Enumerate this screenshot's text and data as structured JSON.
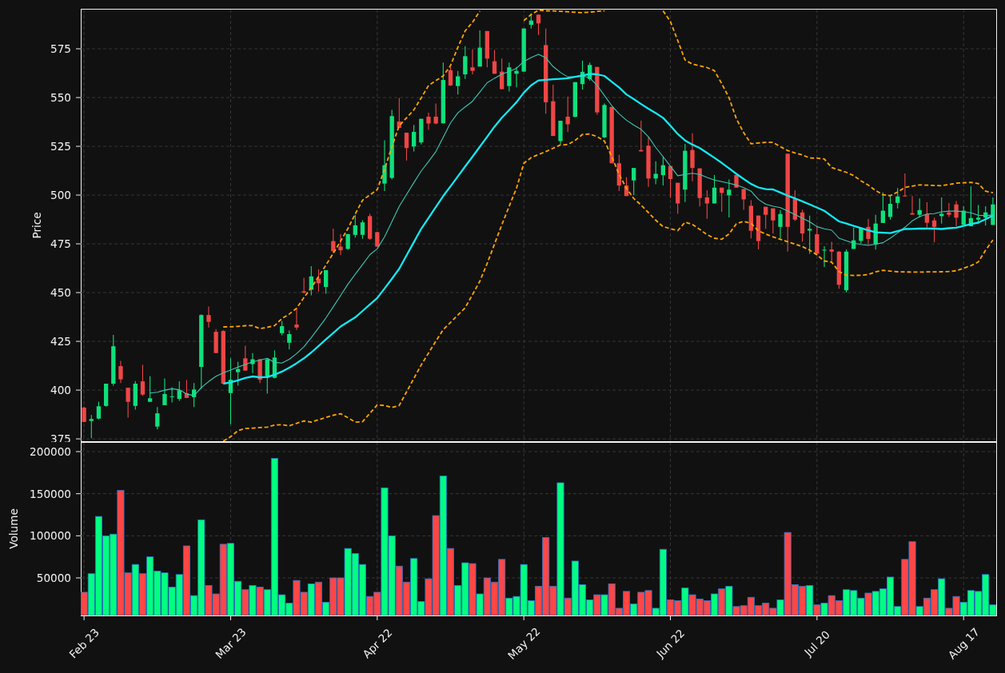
{
  "price_chart": {
    "chart_data": {
      "type": "candlestick",
      "ylabel": "Price",
      "grid": true,
      "ylim": [
        373.8,
        595.1
      ],
      "yticks": [
        375,
        400,
        425,
        450,
        475,
        500,
        525,
        550,
        575
      ],
      "categories": [
        null,
        null,
        null,
        null,
        null,
        null,
        null,
        null,
        null,
        null,
        null,
        null,
        null,
        null,
        null,
        null,
        null,
        null,
        null,
        null,
        null,
        null,
        null,
        null,
        null,
        null,
        null,
        null,
        null,
        null,
        null,
        null,
        null,
        null,
        null,
        null,
        null,
        null,
        null,
        null,
        null,
        null,
        null,
        null,
        null,
        null,
        null,
        null,
        null,
        null,
        null,
        null,
        null,
        null,
        null,
        null,
        null,
        null,
        null,
        null,
        null,
        null,
        null,
        null,
        null,
        null,
        null,
        null,
        null,
        null,
        null,
        null,
        null,
        null,
        null,
        null,
        null,
        null,
        null,
        null,
        null,
        null,
        null,
        null,
        null,
        null,
        null,
        null,
        null,
        null,
        null,
        null,
        null,
        null,
        null,
        null,
        null,
        null,
        null,
        null,
        null,
        null,
        null,
        null,
        null,
        null,
        null,
        null,
        null,
        null,
        null,
        null,
        null,
        null,
        null,
        null,
        null,
        null,
        null,
        null,
        null,
        null,
        null,
        null,
        null
      ],
      "ohlc": [
        [
          391.0,
          391.5,
          383.5,
          383.7
        ],
        [
          384.2,
          387.2,
          375.3,
          385.2
        ],
        [
          385.4,
          394.1,
          385.0,
          391.7
        ],
        [
          391.9,
          403.3,
          391.5,
          403.3
        ],
        [
          403.3,
          428.3,
          402.3,
          422.5
        ],
        [
          412.3,
          415.0,
          403.6,
          405.5
        ],
        [
          401.2,
          401.2,
          385.9,
          394.0
        ],
        [
          391.9,
          404.6,
          390.0,
          403.3
        ],
        [
          404.5,
          413.0,
          397.0,
          397.7
        ],
        [
          394.0,
          407.2,
          394.0,
          395.8
        ],
        [
          381.3,
          391.3,
          379.8,
          388.1
        ],
        [
          392.3,
          406.0,
          392.3,
          398.0
        ],
        [
          396.5,
          401.5,
          393.7,
          396.8
        ],
        [
          395.5,
          404.5,
          394.5,
          399.9
        ],
        [
          398.4,
          405.2,
          396.0,
          396.0
        ],
        [
          396.4,
          403.6,
          391.3,
          400.3
        ],
        [
          411.9,
          438.9,
          400.5,
          438.5
        ],
        [
          438.5,
          442.9,
          432.1,
          435.0
        ],
        [
          429.9,
          431.3,
          419.0,
          419.0
        ],
        [
          430.3,
          430.8,
          403.0,
          403.3
        ],
        [
          398.5,
          416.3,
          382.5,
          405.3
        ],
        [
          409.2,
          414.6,
          402.3,
          410.8
        ],
        [
          416.3,
          422.8,
          410.0,
          410.0
        ],
        [
          413.3,
          419.0,
          408.7,
          415.8
        ],
        [
          415.8,
          416.0,
          403.6,
          405.3
        ],
        [
          406.4,
          416.0,
          398.2,
          415.8
        ],
        [
          406.3,
          420.4,
          406.0,
          416.7
        ],
        [
          429.2,
          435.4,
          428.1,
          432.8
        ],
        [
          424.3,
          430.6,
          420.8,
          428.7
        ],
        [
          433.6,
          441.8,
          430.9,
          432.1
        ],
        [
          450.7,
          457.6,
          449.5,
          450.0
        ],
        [
          451.5,
          463.6,
          448.6,
          458.3
        ],
        [
          457.2,
          461.9,
          450.5,
          454.8
        ],
        [
          452.9,
          461.5,
          449.4,
          461.5
        ],
        [
          476.4,
          482.8,
          470.3,
          471.2
        ],
        [
          473.6,
          480.0,
          469.3,
          471.7
        ],
        [
          472.4,
          480.0,
          472.0,
          480.0
        ],
        [
          479.6,
          490.0,
          478.2,
          484.5
        ],
        [
          479.6,
          487.1,
          477.6,
          486.0
        ],
        [
          489.2,
          490.4,
          477.1,
          477.6
        ],
        [
          481.0,
          481.2,
          473.4,
          473.6
        ],
        [
          505.9,
          528.1,
          502.1,
          515.3
        ],
        [
          508.8,
          543.7,
          508.0,
          540.5
        ],
        [
          537.7,
          549.8,
          534.5,
          534.5
        ],
        [
          532.0,
          532.0,
          517.7,
          524.1
        ],
        [
          524.9,
          536.0,
          522.4,
          532.4
        ],
        [
          527.0,
          539.1,
          525.9,
          539.1
        ],
        [
          540.2,
          542.2,
          533.4,
          536.7
        ],
        [
          540.2,
          546.9,
          536.3,
          536.7
        ],
        [
          536.8,
          568.0,
          536.6,
          559.0
        ],
        [
          564.0,
          565.7,
          555.9,
          556.2
        ],
        [
          555.9,
          563.6,
          551.6,
          560.9
        ],
        [
          561.9,
          576.3,
          559.5,
          571.2
        ],
        [
          565.5,
          574.7,
          561.9,
          563.7
        ],
        [
          565.9,
          584.4,
          565.9,
          575.6
        ],
        [
          584.1,
          584.1,
          565.5,
          570.0
        ],
        [
          568.6,
          574.4,
          562.2,
          562.2
        ],
        [
          563.3,
          570.0,
          554.3,
          554.3
        ],
        [
          555.9,
          568.0,
          553.1,
          565.5
        ],
        [
          562.2,
          565.7,
          555.2,
          563.7
        ],
        [
          563.3,
          585.4,
          563.3,
          585.4
        ],
        [
          587.3,
          593.2,
          585.4,
          589.5
        ],
        [
          592.5,
          592.5,
          582.1,
          588.0
        ],
        [
          576.9,
          585.4,
          541.7,
          547.6
        ],
        [
          548.1,
          556.6,
          530.3,
          530.3
        ],
        [
          527.7,
          538.1,
          526.0,
          538.1
        ],
        [
          540.2,
          550.5,
          532.4,
          536.3
        ],
        [
          540.1,
          557.9,
          540.0,
          557.9
        ],
        [
          556.9,
          568.9,
          554.1,
          563.2
        ],
        [
          559.5,
          568.0,
          558.6,
          566.7
        ],
        [
          565.7,
          565.7,
          541.2,
          542.4
        ],
        [
          529.6,
          547.0,
          529.1,
          546.2
        ],
        [
          545.2,
          545.2,
          516.3,
          516.3
        ],
        [
          516.3,
          520.6,
          502.1,
          504.9
        ],
        [
          504.9,
          509.2,
          499.5,
          499.5
        ],
        [
          507.5,
          513.9,
          499.9,
          513.9
        ],
        [
          523.1,
          538.1,
          522.4,
          522.4
        ],
        [
          525.3,
          529.6,
          504.2,
          508.5
        ],
        [
          508.5,
          517.3,
          505.6,
          510.9
        ],
        [
          510.2,
          519.9,
          504.9,
          515.3
        ],
        [
          514.9,
          515.0,
          498.5,
          508.2
        ],
        [
          506.3,
          506.3,
          490.4,
          495.7
        ],
        [
          502.8,
          526.3,
          496.4,
          522.7
        ],
        [
          523.1,
          531.7,
          507.1,
          513.9
        ],
        [
          513.7,
          513.7,
          494.2,
          498.5
        ],
        [
          498.8,
          502.5,
          487.8,
          495.7
        ],
        [
          495.7,
          510.3,
          495.7,
          503.8
        ],
        [
          503.8,
          503.8,
          491.4,
          501.1
        ],
        [
          499.9,
          508.0,
          488.5,
          502.8
        ],
        [
          510.3,
          510.3,
          503.8,
          503.8
        ],
        [
          503.1,
          503.1,
          492.4,
          497.8
        ],
        [
          494.5,
          497.4,
          477.8,
          481.7
        ],
        [
          489.5,
          489.5,
          472.2,
          476.4
        ],
        [
          494.0,
          494.0,
          482.7,
          489.9
        ],
        [
          493.2,
          493.2,
          480.2,
          487.0
        ],
        [
          483.7,
          492.2,
          477.9,
          490.3
        ],
        [
          521.2,
          521.2,
          471.0,
          483.7
        ],
        [
          498.4,
          502.5,
          486.7,
          487.4
        ],
        [
          491.1,
          492.5,
          476.1,
          480.3
        ],
        [
          481.8,
          489.5,
          469.9,
          482.7
        ],
        [
          479.9,
          484.3,
          469.9,
          469.9
        ],
        [
          471.7,
          473.8,
          463.1,
          472.0
        ],
        [
          472.1,
          476.1,
          465.8,
          471.0
        ],
        [
          471.0,
          471.2,
          452.0,
          454.0
        ],
        [
          451.2,
          472.1,
          450.1,
          471.0
        ],
        [
          472.4,
          483.3,
          472.4,
          476.8
        ],
        [
          476.5,
          483.0,
          475.1,
          483.0
        ],
        [
          483.7,
          487.7,
          474.5,
          477.5
        ],
        [
          474.7,
          489.9,
          472.1,
          485.4
        ],
        [
          485.7,
          501.4,
          485.7,
          492.0
        ],
        [
          488.8,
          499.7,
          487.4,
          495.5
        ],
        [
          496.0,
          503.6,
          493.2,
          499.3
        ],
        [
          499.7,
          511.1,
          499.3,
          499.3
        ],
        [
          490.7,
          499.5,
          490.0,
          490.0
        ],
        [
          489.9,
          498.3,
          488.4,
          492.3
        ],
        [
          490.2,
          496.3,
          483.3,
          485.8
        ],
        [
          487.0,
          488.4,
          475.8,
          483.7
        ],
        [
          489.2,
          498.8,
          485.4,
          490.4
        ],
        [
          491.1,
          495.9,
          488.8,
          489.9
        ],
        [
          495.2,
          497.0,
          484.0,
          488.4
        ],
        [
          484.7,
          494.3,
          484.7,
          492.0
        ],
        [
          484.0,
          504.5,
          484.0,
          488.2
        ],
        [
          487.4,
          494.9,
          485.1,
          488.4
        ],
        [
          488.4,
          494.3,
          484.3,
          491.1
        ],
        [
          484.7,
          498.8,
          484.7,
          495.2
        ]
      ],
      "series": [
        {
          "type": "line",
          "line_style": "solid",
          "color": "#3fc7b6",
          "values": [
            null,
            null,
            null,
            null,
            null,
            null,
            null,
            null,
            null,
            398.5,
            398.9,
            400.0,
            400.7,
            400.2,
            398.0,
            397.1,
            401.3,
            404.4,
            407.1,
            408.8,
            410.3,
            411.8,
            413.2,
            414.5,
            415.4,
            416.3,
            414.2,
            413.9,
            415.8,
            418.7,
            422.2,
            426.9,
            431.9,
            437.0,
            442.7,
            448.5,
            454.3,
            459.4,
            464.4,
            469.5,
            472.4,
            478.6,
            486.4,
            494.2,
            500.3,
            506.4,
            512.3,
            517.2,
            522.3,
            529.6,
            537.0,
            542.2,
            545.2,
            548.1,
            552.8,
            557.6,
            559.9,
            562.0,
            563.4,
            565.0,
            568.5,
            570.5,
            572.2,
            570.4,
            565.9,
            562.9,
            560.5,
            560.8,
            561.2,
            560.0,
            556.3,
            551.0,
            545.8,
            541.7,
            538.4,
            535.9,
            533.7,
            529.9,
            524.4,
            519.7,
            514.8,
            509.9,
            510.6,
            511.2,
            510.6,
            509.1,
            507.7,
            506.9,
            506.1,
            505.1,
            503.8,
            502.0,
            497.8,
            495.3,
            494.3,
            493.6,
            491.8,
            490.0,
            488.1,
            486.3,
            483.8,
            482.7,
            482.0,
            477.9,
            476.6,
            475.3,
            474.7,
            474.2,
            474.8,
            475.6,
            477.9,
            480.6,
            483.5,
            486.8,
            488.9,
            490.3,
            490.5,
            491.4,
            491.8,
            491.8,
            491.5,
            490.9,
            489.7,
            489.4,
            489.8
          ]
        },
        {
          "type": "line",
          "line_style": "solid",
          "color": "#12e9f5",
          "values": [
            null,
            null,
            null,
            null,
            null,
            null,
            null,
            null,
            null,
            null,
            null,
            null,
            null,
            null,
            null,
            null,
            null,
            null,
            null,
            403.3,
            404.0,
            405.0,
            406.2,
            407.0,
            406.6,
            406.7,
            407.9,
            409.5,
            411.5,
            413.8,
            416.3,
            419.3,
            422.6,
            426.0,
            429.3,
            432.6,
            435.0,
            437.3,
            440.6,
            443.9,
            447.2,
            452.1,
            457.1,
            462.2,
            469.1,
            475.9,
            482.7,
            488.3,
            493.9,
            499.5,
            504.5,
            509.6,
            514.7,
            519.7,
            524.8,
            529.9,
            535.1,
            539.7,
            543.6,
            547.6,
            552.5,
            556.3,
            558.8,
            559.1,
            559.4,
            559.6,
            559.9,
            560.6,
            561.3,
            562.2,
            561.9,
            561.1,
            558.1,
            555.2,
            551.6,
            549.2,
            546.7,
            544.3,
            542.0,
            539.6,
            535.6,
            531.3,
            528.0,
            525.9,
            524.1,
            521.6,
            519.1,
            516.5,
            513.7,
            510.9,
            508.2,
            505.7,
            503.9,
            503.0,
            502.9,
            501.3,
            499.7,
            498.3,
            496.8,
            495.2,
            493.6,
            491.9,
            489.2,
            486.5,
            485.4,
            484.2,
            483.1,
            481.9,
            480.9,
            480.7,
            480.5,
            481.5,
            482.6,
            482.7,
            482.8,
            482.9,
            482.8,
            482.6,
            483.0,
            483.3,
            484.2,
            485.1,
            485.9,
            487.6,
            489.5
          ]
        },
        {
          "type": "line",
          "line_style": "dashed",
          "color": "#ffa500",
          "values": [
            null,
            null,
            null,
            null,
            null,
            null,
            null,
            null,
            null,
            null,
            null,
            null,
            null,
            null,
            null,
            null,
            null,
            null,
            null,
            432.4,
            432.5,
            432.7,
            433.0,
            433.1,
            431.5,
            432.2,
            433.1,
            436.7,
            439.0,
            442.0,
            447.5,
            452.5,
            458.2,
            464.1,
            470.1,
            476.4,
            482.8,
            490.3,
            497.4,
            500.1,
            502.8,
            513.2,
            524.9,
            535.6,
            539.6,
            543.7,
            549.8,
            556.2,
            558.7,
            561.1,
            566.4,
            575.8,
            584.2,
            588.6,
            594.4,
            null,
            null,
            null,
            null,
            null,
            589.5,
            592.5,
            594.8,
            594.5,
            594.4,
            594.2,
            594.0,
            593.7,
            593.5,
            593.8,
            594.2,
            594.4,
            null,
            null,
            null,
            null,
            null,
            null,
            null,
            594.5,
            589.0,
            579.2,
            569.3,
            567.1,
            566.3,
            565.4,
            563.8,
            557.2,
            549.8,
            539.1,
            532.0,
            526.3,
            526.7,
            527.0,
            527.0,
            524.8,
            522.8,
            521.6,
            520.6,
            519.0,
            518.9,
            518.5,
            514.1,
            512.9,
            511.7,
            510.0,
            507.3,
            505.1,
            502.3,
            500.2,
            499.7,
            501.6,
            503.9,
            504.6,
            505.2,
            505.1,
            504.9,
            504.8,
            505.4,
            506.1,
            506.3,
            506.5,
            505.9,
            502.0,
            501.2
          ]
        },
        {
          "type": "line",
          "line_style": "dashed",
          "color": "#ffa500",
          "values": [
            null,
            null,
            null,
            null,
            null,
            null,
            null,
            null,
            null,
            null,
            null,
            null,
            null,
            null,
            null,
            null,
            null,
            null,
            null,
            373.9,
            376.1,
            379.2,
            380.3,
            380.5,
            380.8,
            381.0,
            382.1,
            382.3,
            381.7,
            383.0,
            384.2,
            383.6,
            384.8,
            386.0,
            387.1,
            387.9,
            385.9,
            383.6,
            383.8,
            388.1,
            392.4,
            392.1,
            391.1,
            392.1,
            399.1,
            406.0,
            412.9,
            419.0,
            425.1,
            431.0,
            434.7,
            438.5,
            442.2,
            449.0,
            455.9,
            464.9,
            474.9,
            484.8,
            494.2,
            503.5,
            516.3,
            519.2,
            520.8,
            522.3,
            524.0,
            525.7,
            525.9,
            528.0,
            531.1,
            531.3,
            530.0,
            527.7,
            519.7,
            510.6,
            503.5,
            498.2,
            494.9,
            491.0,
            487.1,
            483.8,
            482.8,
            481.8,
            486.1,
            485.0,
            482.4,
            479.7,
            477.9,
            477.3,
            480.1,
            485.3,
            486.5,
            485.5,
            481.7,
            480.0,
            478.6,
            477.3,
            476.1,
            474.8,
            473.6,
            471.8,
            469.3,
            466.2,
            465.6,
            460.8,
            458.9,
            458.8,
            458.9,
            459.3,
            460.6,
            461.4,
            461.0,
            460.7,
            460.6,
            460.5,
            460.5,
            460.6,
            460.6,
            460.7,
            460.8,
            461.2,
            462.5,
            463.8,
            465.7,
            471.7,
            477.0
          ]
        }
      ]
    }
  },
  "volume_chart": {
    "chart_data": {
      "type": "bar",
      "ylabel": "Volume",
      "grid": true,
      "ylim": [
        5400,
        211400
      ],
      "yticks": [
        50000,
        100000,
        150000,
        200000
      ],
      "categories": [
        "Feb 23",
        null,
        null,
        null,
        null,
        null,
        null,
        null,
        null,
        null,
        null,
        null,
        null,
        null,
        null,
        null,
        null,
        null,
        null,
        null,
        "Mar 23",
        null,
        null,
        null,
        null,
        null,
        null,
        null,
        null,
        null,
        null,
        null,
        null,
        null,
        null,
        null,
        null,
        null,
        null,
        null,
        "Apr 22",
        null,
        null,
        null,
        null,
        null,
        null,
        null,
        null,
        null,
        null,
        null,
        null,
        null,
        null,
        null,
        null,
        null,
        null,
        null,
        "May 22",
        null,
        null,
        null,
        null,
        null,
        null,
        null,
        null,
        null,
        null,
        null,
        null,
        null,
        null,
        null,
        null,
        null,
        null,
        null,
        "Jun 22",
        null,
        null,
        null,
        null,
        null,
        null,
        null,
        null,
        null,
        null,
        null,
        null,
        null,
        null,
        null,
        null,
        null,
        null,
        null,
        "Jul 20",
        null,
        null,
        null,
        null,
        null,
        null,
        null,
        null,
        null,
        null,
        null,
        null,
        null,
        null,
        null,
        null,
        null,
        null,
        null,
        "Aug 17",
        null,
        null,
        null,
        null
      ],
      "values": [
        33000,
        55000,
        123000,
        100000,
        102000,
        154000,
        56000,
        66000,
        55000,
        75000,
        58000,
        56000,
        39000,
        54000,
        88000,
        29000,
        119000,
        41000,
        31000,
        90000,
        91000,
        46000,
        36000,
        41000,
        39000,
        36000,
        192000,
        30000,
        20000,
        47000,
        33000,
        43000,
        45000,
        21000,
        50000,
        50000,
        85000,
        79000,
        66000,
        28000,
        33000,
        157000,
        100000,
        64000,
        45000,
        73000,
        22000,
        49000,
        124000,
        171000,
        85000,
        41000,
        68000,
        67000,
        31000,
        50000,
        45000,
        72000,
        26000,
        28000,
        66000,
        23000,
        40000,
        98000,
        40000,
        163000,
        26000,
        70000,
        42000,
        24000,
        30000,
        30000,
        43000,
        14000,
        34000,
        19000,
        33000,
        35000,
        14000,
        84000,
        24000,
        23000,
        38000,
        30000,
        25000,
        23000,
        31000,
        37000,
        40000,
        16000,
        17000,
        27000,
        17000,
        20000,
        14000,
        24000,
        104000,
        42000,
        40000,
        41000,
        18000,
        20000,
        29000,
        23000,
        36000,
        35000,
        26000,
        32000,
        34000,
        37000,
        51000,
        16000,
        72000,
        93000,
        16000,
        26000,
        36000,
        49000,
        14000,
        28000,
        21000,
        35000,
        34000,
        54000,
        18000
      ]
    }
  }
}
